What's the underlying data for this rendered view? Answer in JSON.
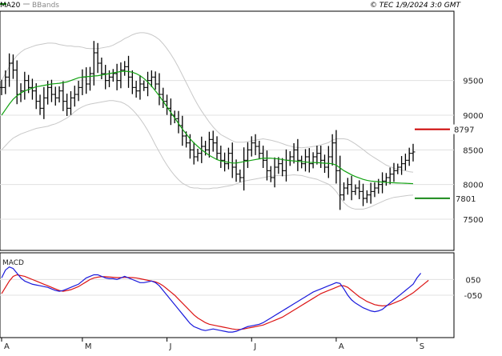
{
  "header": {
    "ma_label": "MA20",
    "bb_label": "BBands",
    "copyright": "© TEC 1/9/2024 3:0 GMT"
  },
  "colors": {
    "ma": "#12a212",
    "macd": "#1a1adc",
    "signal": "#dc1414",
    "bands": "#c8c8c8",
    "bars": "#000000",
    "resistance": "#cc0000",
    "support": "#1a8a1a",
    "grid": "#e0e0e0"
  },
  "chart_data": [
    {
      "type": "ohlc",
      "ylim": [
        7050,
        10500
      ],
      "y_ticks": [
        7500,
        8000,
        8500,
        9000,
        9500
      ],
      "y_tick_labels": [
        "7500",
        "8000",
        "8500",
        "9000",
        "9500"
      ],
      "x_labels": [
        "A",
        "M",
        "J",
        "J",
        "A",
        "S"
      ],
      "x_label_index": [
        0,
        21,
        43,
        65,
        87,
        108
      ],
      "n": 108,
      "close": [
        9400,
        9550,
        9750,
        9650,
        9300,
        9350,
        9500,
        9400,
        9350,
        9200,
        9100,
        9250,
        9400,
        9300,
        9250,
        9350,
        9200,
        9100,
        9250,
        9300,
        9400,
        9550,
        9450,
        9600,
        9900,
        9750,
        9600,
        9500,
        9550,
        9600,
        9500,
        9650,
        9700,
        9550,
        9400,
        9350,
        9450,
        9400,
        9500,
        9550,
        9450,
        9300,
        9200,
        9100,
        9000,
        8950,
        8850,
        8700,
        8600,
        8500,
        8400,
        8450,
        8550,
        8500,
        8650,
        8600,
        8450,
        8350,
        8300,
        8450,
        8250,
        8150,
        8100,
        8350,
        8500,
        8600,
        8550,
        8450,
        8350,
        8200,
        8100,
        8250,
        8300,
        8200,
        8350,
        8400,
        8500,
        8350,
        8300,
        8400,
        8300,
        8400,
        8450,
        8350,
        8250,
        8400,
        8600,
        8200,
        7850,
        7950,
        8000,
        7900,
        7950,
        7900,
        7800,
        7850,
        7900,
        7950,
        8000,
        8050,
        8100,
        8150,
        8200,
        8250,
        8300,
        8350,
        8450,
        8470
      ],
      "ma20": [
        9000,
        9080,
        9160,
        9230,
        9280,
        9320,
        9350,
        9370,
        9390,
        9410,
        9420,
        9430,
        9440,
        9450,
        9455,
        9460,
        9470,
        9480,
        9500,
        9520,
        9540,
        9550,
        9555,
        9560,
        9565,
        9570,
        9580,
        9590,
        9600,
        9610,
        9620,
        9630,
        9635,
        9630,
        9620,
        9600,
        9570,
        9530,
        9480,
        9420,
        9350,
        9280,
        9200,
        9120,
        9040,
        8960,
        8880,
        8800,
        8730,
        8660,
        8600,
        8550,
        8500,
        8460,
        8420,
        8390,
        8360,
        8340,
        8330,
        8320,
        8310,
        8310,
        8320,
        8330,
        8340,
        8350,
        8360,
        8370,
        8380,
        8380,
        8380,
        8375,
        8370,
        8360,
        8350,
        8345,
        8340,
        8335,
        8330,
        8325,
        8320,
        8318,
        8316,
        8312,
        8308,
        8305,
        8300,
        8280,
        8240,
        8200,
        8170,
        8140,
        8115,
        8095,
        8075,
        8060,
        8050,
        8045,
        8040,
        8035,
        8030,
        8028,
        8025,
        8022,
        8020,
        8018,
        8015,
        8013
      ],
      "band_width": [
        500,
        520,
        540,
        560,
        580,
        590,
        600,
        600,
        600,
        600,
        600,
        600,
        600,
        590,
        580,
        560,
        540,
        520,
        500,
        470,
        450,
        430,
        410,
        400,
        395,
        390,
        390,
        390,
        390,
        400,
        420,
        440,
        470,
        500,
        540,
        580,
        620,
        660,
        700,
        740,
        780,
        810,
        830,
        840,
        840,
        830,
        810,
        780,
        740,
        700,
        650,
        600,
        560,
        520,
        480,
        440,
        410,
        380,
        360,
        340,
        320,
        300,
        290,
        280,
        280,
        280,
        280,
        280,
        280,
        270,
        260,
        250,
        240,
        230,
        220,
        210,
        200,
        200,
        200,
        210,
        220,
        230,
        240,
        260,
        280,
        300,
        340,
        380,
        420,
        460,
        480,
        480,
        470,
        450,
        430,
        400,
        370,
        340,
        310,
        280,
        250,
        230,
        210,
        200,
        190,
        180,
        170,
        165
      ],
      "lines": [
        {
          "name": "",
          "value": 8797,
          "label": "8797",
          "color": "#cc0000"
        },
        {
          "name": "",
          "value": 7801,
          "label": "7801",
          "color": "#1a8a1a"
        }
      ]
    },
    {
      "type": "line",
      "title": "MACD",
      "ylim": [
        -320,
        220
      ],
      "y_ticks": [
        50,
        -50
      ],
      "y_tick_labels": [
        "050",
        "-050"
      ],
      "macd": [
        60,
        110,
        130,
        120,
        90,
        60,
        40,
        30,
        20,
        15,
        10,
        5,
        0,
        -10,
        -20,
        -25,
        -20,
        -10,
        0,
        10,
        20,
        40,
        60,
        70,
        80,
        80,
        70,
        60,
        55,
        55,
        50,
        60,
        70,
        60,
        50,
        40,
        30,
        30,
        35,
        40,
        30,
        10,
        -20,
        -50,
        -80,
        -110,
        -140,
        -170,
        -200,
        -230,
        -250,
        -260,
        -270,
        -275,
        -270,
        -265,
        -270,
        -275,
        -280,
        -285,
        -285,
        -280,
        -270,
        -260,
        -250,
        -245,
        -240,
        -235,
        -225,
        -210,
        -195,
        -180,
        -165,
        -150,
        -135,
        -120,
        -105,
        -90,
        -75,
        -60,
        -45,
        -30,
        -20,
        -10,
        0,
        10,
        20,
        30,
        25,
        -10,
        -50,
        -80,
        -100,
        -115,
        -130,
        -140,
        -150,
        -155,
        -150,
        -140,
        -120,
        -100,
        -80,
        -60,
        -40,
        -20,
        0,
        20,
        60,
        90
      ],
      "signal": [
        -40,
        0,
        40,
        70,
        80,
        75,
        70,
        60,
        50,
        40,
        30,
        20,
        10,
        0,
        -10,
        -20,
        -25,
        -20,
        -15,
        -5,
        5,
        20,
        35,
        50,
        60,
        65,
        68,
        68,
        66,
        64,
        62,
        62,
        63,
        63,
        62,
        60,
        55,
        50,
        45,
        40,
        35,
        25,
        10,
        -10,
        -30,
        -50,
        -75,
        -100,
        -125,
        -150,
        -175,
        -195,
        -210,
        -225,
        -235,
        -240,
        -245,
        -250,
        -255,
        -260,
        -265,
        -268,
        -268,
        -265,
        -260,
        -255,
        -250,
        -245,
        -240,
        -230,
        -220,
        -210,
        -200,
        -190,
        -175,
        -160,
        -145,
        -130,
        -115,
        -100,
        -85,
        -70,
        -55,
        -40,
        -30,
        -20,
        -10,
        0,
        10,
        10,
        0,
        -20,
        -40,
        -60,
        -75,
        -90,
        -100,
        -110,
        -115,
        -118,
        -116,
        -110,
        -100,
        -90,
        -80,
        -65,
        -50,
        -35,
        -15,
        5,
        25,
        45
      ]
    }
  ]
}
